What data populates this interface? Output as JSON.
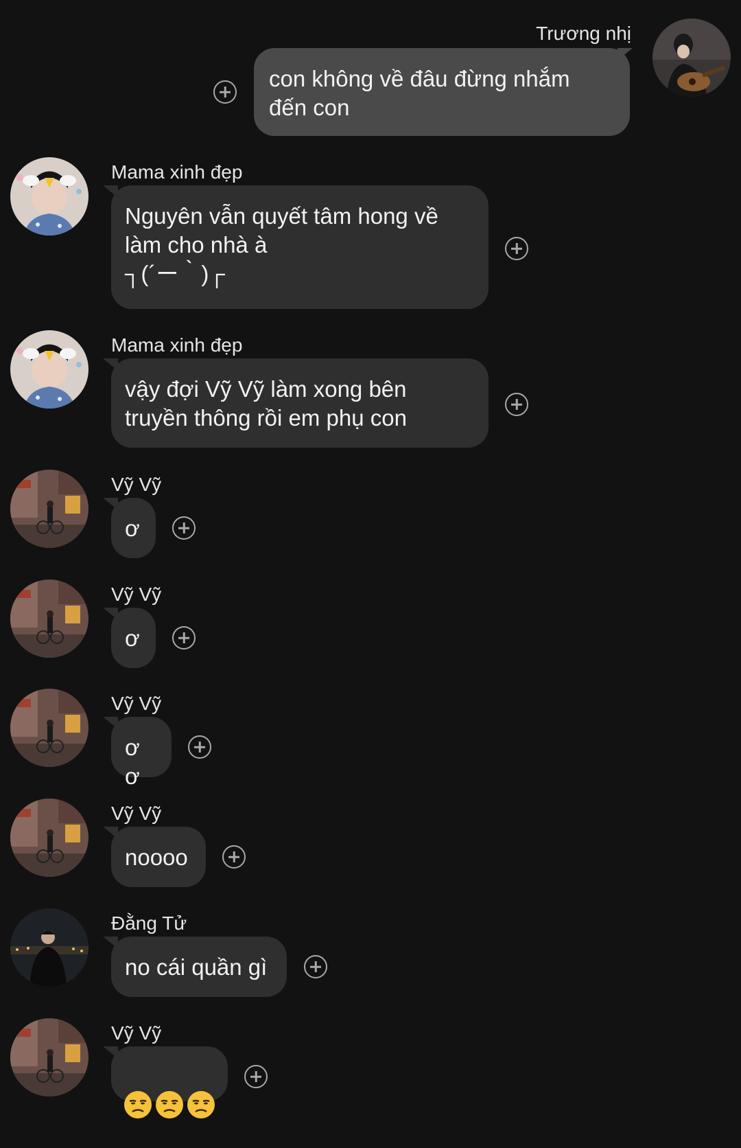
{
  "messages": [
    {
      "sender": "Trương nhị",
      "text": "con không về đâu đừng nhắm\nđến con",
      "outgoing": true,
      "avatar": "guitar-player-avatar"
    },
    {
      "sender": "Mama xinh đẹp",
      "text": "Nguyên vẫn quyết tâm hong về\nlàm cho nhà à\n┐(´ー｀)┌",
      "outgoing": false,
      "avatar": "cow-ears-avatar"
    },
    {
      "sender": "Mama xinh đẹp",
      "text": "vậy đợi Vỹ Vỹ làm xong bên\ntruyền thông rồi em phụ con",
      "outgoing": false,
      "avatar": "cow-ears-avatar"
    },
    {
      "sender": "Vỹ Vỹ",
      "text": "ơ",
      "outgoing": false,
      "avatar": "street-bicycle-avatar"
    },
    {
      "sender": "Vỹ Vỹ",
      "text": "ơ",
      "outgoing": false,
      "avatar": "street-bicycle-avatar"
    },
    {
      "sender": "Vỹ Vỹ",
      "text": "ơ ơ",
      "outgoing": false,
      "avatar": "street-bicycle-avatar"
    },
    {
      "sender": "Vỹ Vỹ",
      "text": "noooo",
      "outgoing": false,
      "avatar": "street-bicycle-avatar"
    },
    {
      "sender": "Đằng Tử",
      "text": "no cái quần gì",
      "outgoing": false,
      "avatar": "night-city-avatar"
    },
    {
      "sender": "Vỹ Vỹ",
      "text": "",
      "emojis": [
        "unamused-face",
        "unamused-face",
        "unamused-face"
      ],
      "outgoing": false,
      "avatar": "street-bicycle-avatar"
    }
  ],
  "colors": {
    "background": "#121212",
    "incoming_bubble": "#2f2f2f",
    "outgoing_bubble": "#4a4a4a",
    "reaction_icon": "#a9a9a9"
  },
  "icons": {
    "reaction": "add-reaction-icon",
    "emoji": "unamused-face-emoji"
  }
}
